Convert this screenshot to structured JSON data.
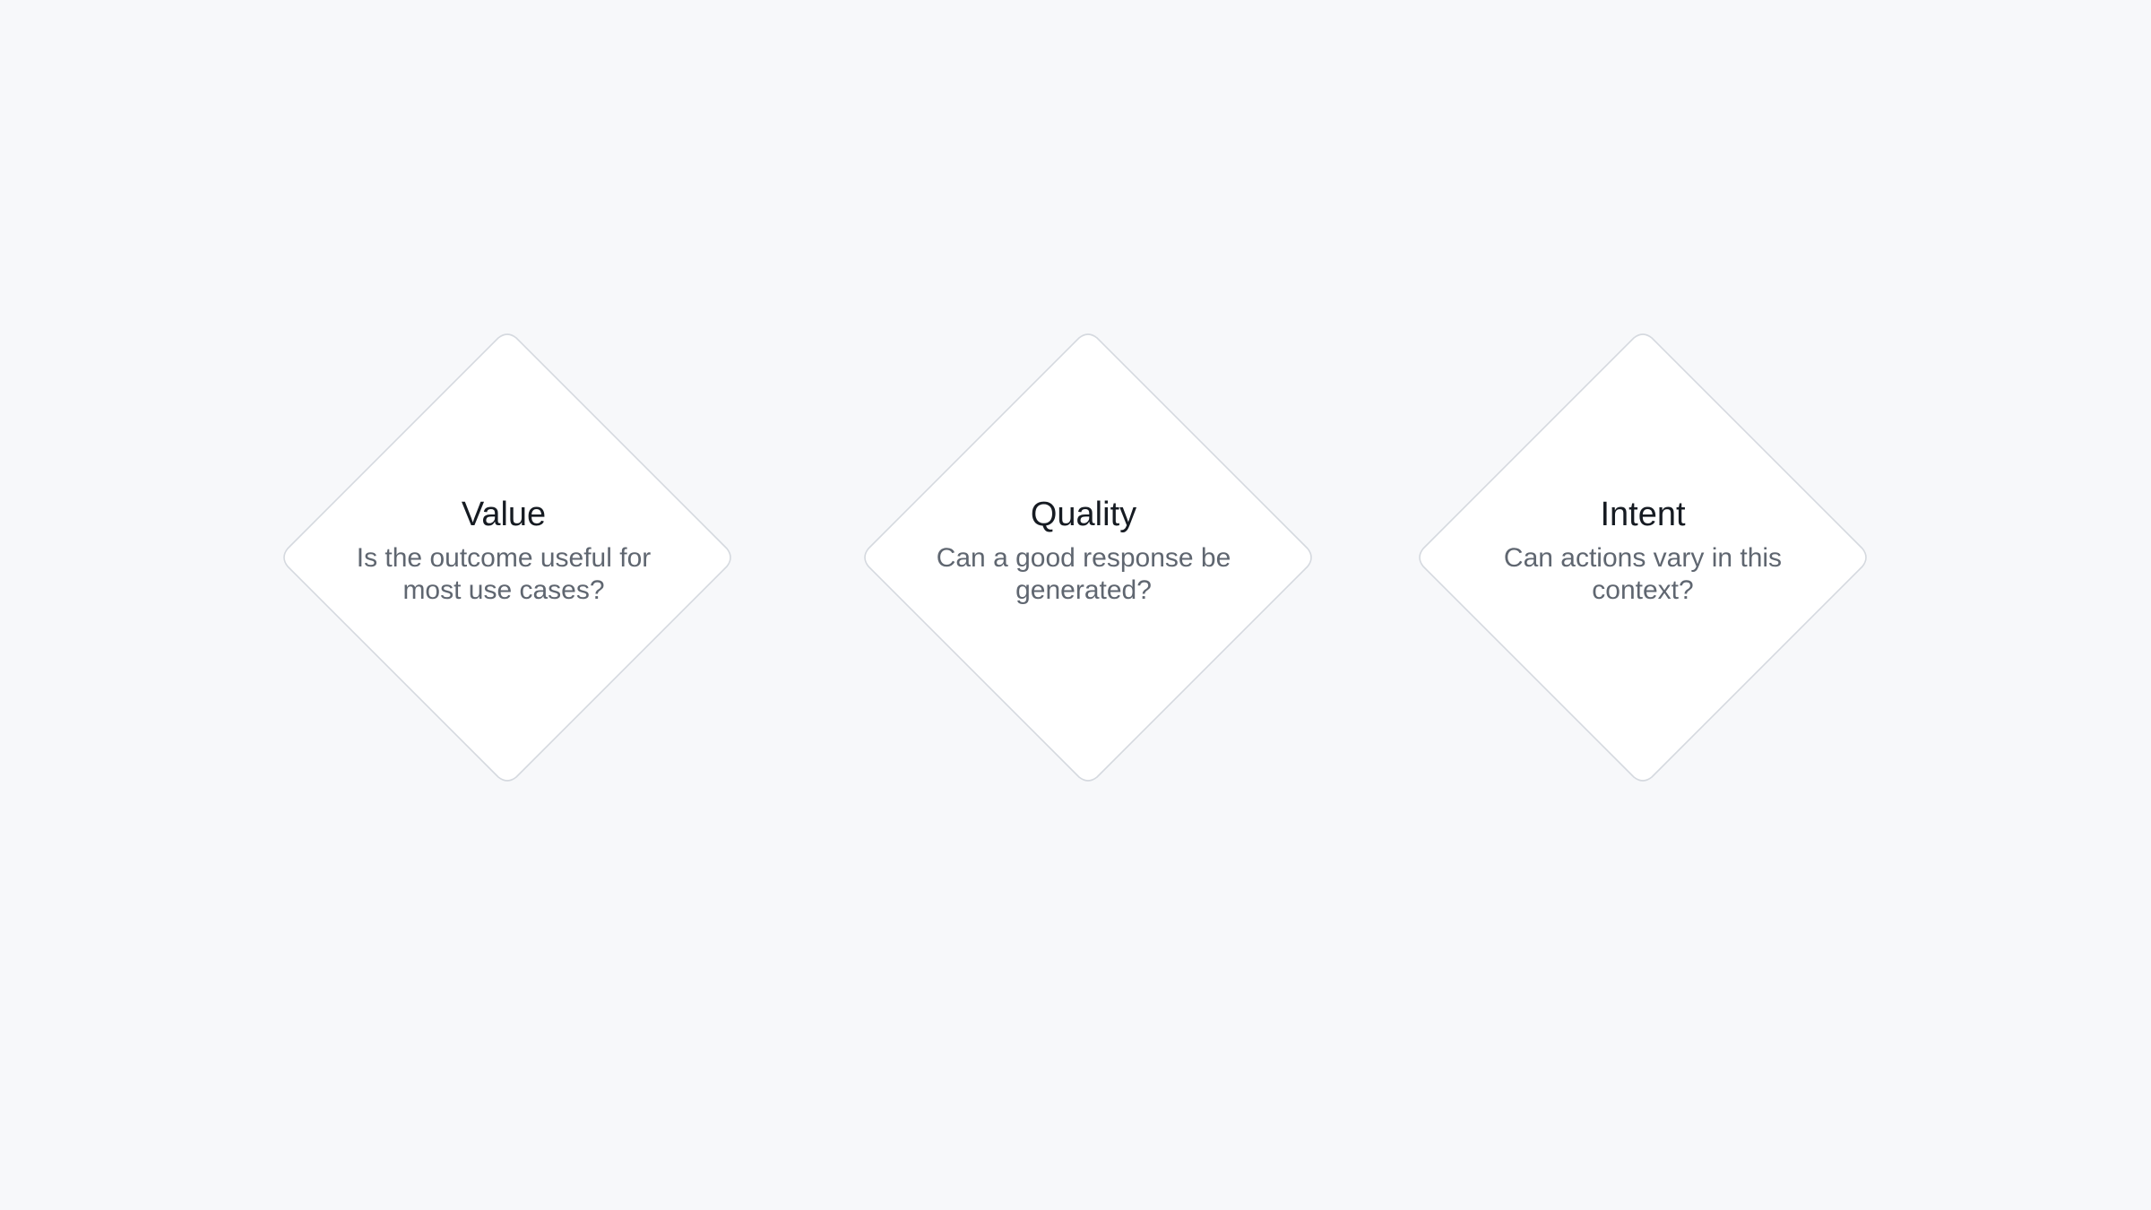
{
  "diagram": {
    "nodes": [
      {
        "title": "Value",
        "description": "Is the outcome useful for most use cases?"
      },
      {
        "title": "Quality",
        "description": "Can a good response be generated?"
      },
      {
        "title": "Intent",
        "description": "Can actions vary in this context?"
      }
    ]
  },
  "colors": {
    "background": "#f7f8fa",
    "node_fill": "#ffffff",
    "node_border": "#d5d9df",
    "title_text": "#161b22",
    "description_text": "#5f6670"
  }
}
